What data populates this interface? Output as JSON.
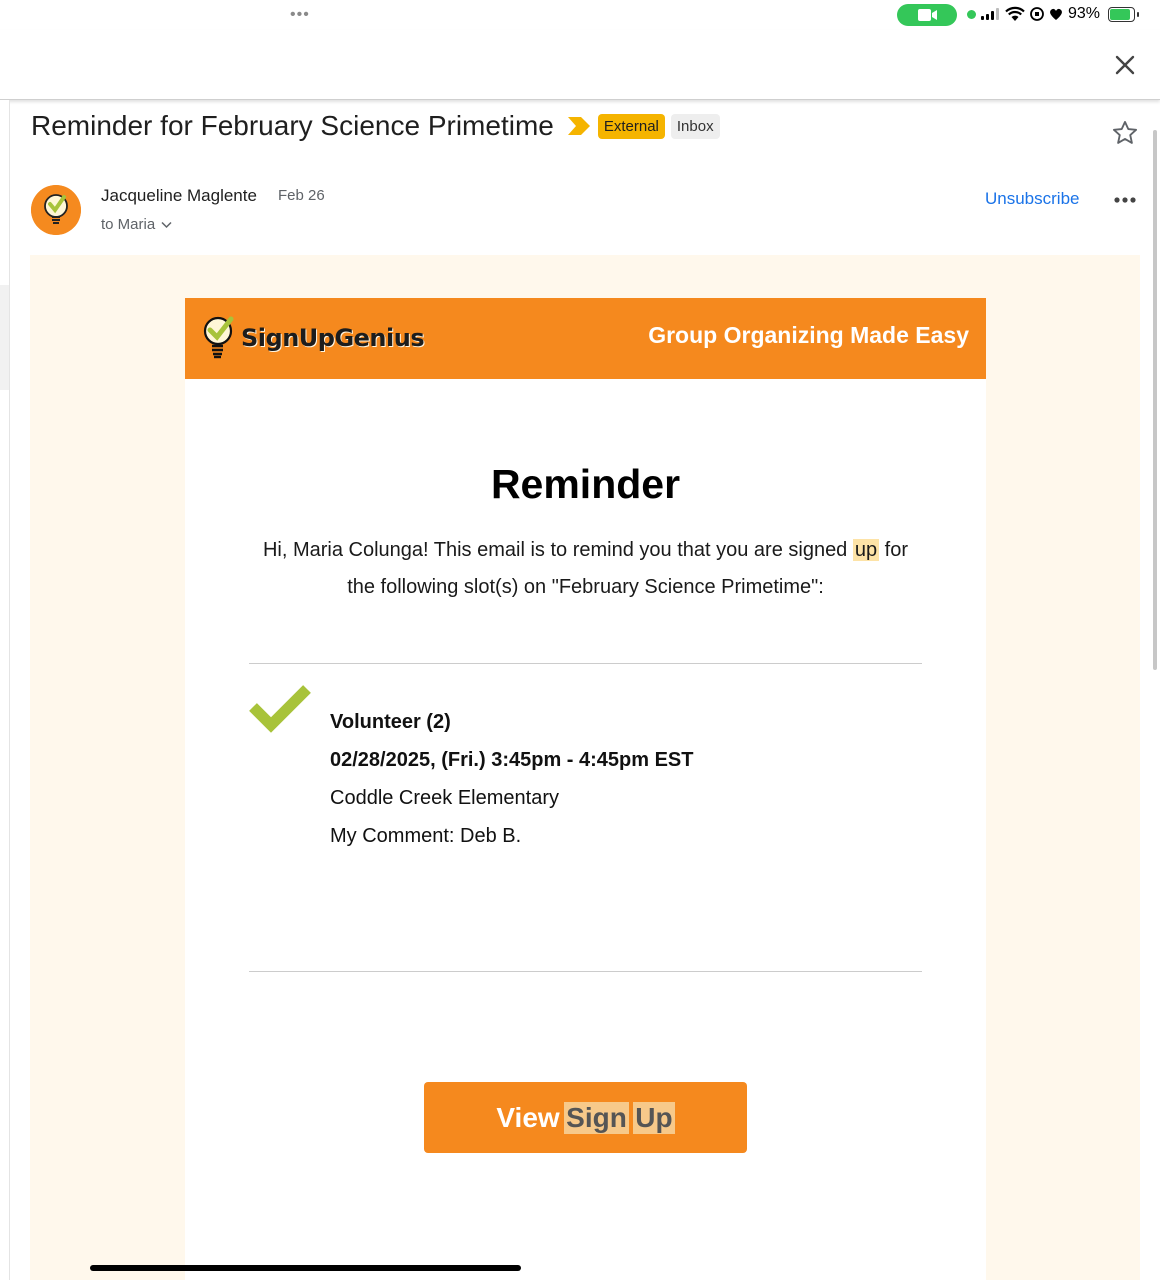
{
  "status_bar": {
    "menu_dots": "•••",
    "battery_percent": "93%",
    "battery_level": 0.93,
    "colors": {
      "active": "#34c759"
    }
  },
  "email": {
    "subject": "Reminder for February Science Primetime",
    "labels": [
      "External",
      "Inbox"
    ],
    "sender_name": "Jacqueline Maglente",
    "date": "Feb 26",
    "recipient": "to Maria",
    "unsubscribe_label": "Unsubscribe"
  },
  "body": {
    "brand": "SignUpGenius",
    "tagline": "Group Organizing Made Easy",
    "heading": "Reminder",
    "intro_before": "Hi, Maria Colunga! This email is to remind you that you are signed ",
    "intro_highlight": "up",
    "intro_after": " for the following slot(s) on \"February Science Primetime\":",
    "slot": {
      "title": "Volunteer (2)",
      "datetime": "02/28/2025, (Fri.) 3:45pm - 4:45pm EST",
      "location": "Coddle Creek Elementary",
      "comment": "My Comment: Deb B."
    },
    "button": {
      "word1": "View",
      "word2": "Sign",
      "word3": "Up"
    },
    "colors": {
      "brand_orange": "#f5891e",
      "check_green": "#a8c33a",
      "highlight": "#fde3a7",
      "background": "#fff8ec"
    }
  },
  "icons": {
    "close": "close-icon",
    "star": "star-icon",
    "more": "more-horizontal-icon",
    "chevron": "chevron-down-icon",
    "check": "checkmark-icon",
    "importance": "importance-marker-icon"
  }
}
